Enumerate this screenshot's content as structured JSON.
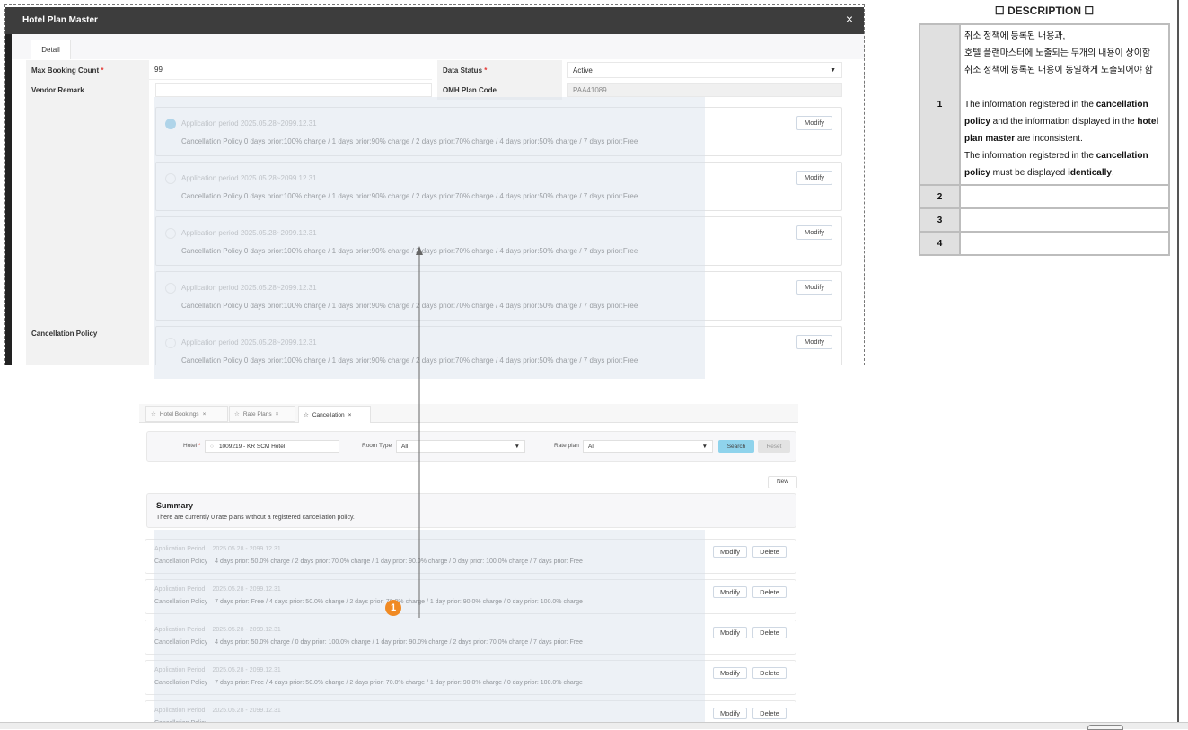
{
  "hotel_plan_master": {
    "title": "Hotel Plan Master",
    "close_icon": "×",
    "tab": "Detail",
    "max_booking_label": "Max Booking Count",
    "max_booking_value": "99",
    "vendor_remark_label": "Vendor Remark",
    "vendor_remark_value": "",
    "data_status_label": "Data Status",
    "data_status_value": "Active",
    "omh_plan_code_label": "OMH Plan Code",
    "omh_plan_code_value": "PAA41089",
    "cancellation_policy_label": "Cancellation Policy",
    "required_mark": "*",
    "modify_label": "Modify",
    "policies": [
      {
        "period": "Application period 2025.05.28~2099.12.31",
        "policy": "Cancellation Policy 0 days prior:100% charge / 1 days prior:90% charge / 2 days prior:70% charge / 4 days prior:50% charge / 7 days prior:Free",
        "selected": true
      },
      {
        "period": "Application period 2025.05.28~2099.12.31",
        "policy": "Cancellation Policy 0 days prior:100% charge / 1 days prior:90% charge / 2 days prior:70% charge / 4 days prior:50% charge / 7 days prior:Free",
        "selected": false
      },
      {
        "period": "Application period 2025.05.28~2099.12.31",
        "policy": "Cancellation Policy 0 days prior:100% charge / 1 days prior:90% charge / 2 days prior:70% charge / 4 days prior:50% charge / 7 days prior:Free",
        "selected": false
      },
      {
        "period": "Application period 2025.05.28~2099.12.31",
        "policy": "Cancellation Policy 0 days prior:100% charge / 1 days prior:90% charge / 2 days prior:70% charge / 4 days prior:50% charge / 7 days prior:Free",
        "selected": false
      },
      {
        "period": "Application period 2025.05.28~2099.12.31",
        "policy": "Cancellation Policy 0 days prior:100% charge / 1 days prior:90% charge / 2 days prior:70% charge / 4 days prior:50% charge / 7 days prior:Free",
        "selected": false
      }
    ]
  },
  "cancellation_page": {
    "tabs": [
      {
        "label": "Hotel Bookings"
      },
      {
        "label": "Rate Plans"
      },
      {
        "label": "Cancellation"
      }
    ],
    "tab_close": "×",
    "star_icon": "☆",
    "hotel_label": "Hotel",
    "hotel_value": "1009219 - KR SCM Hotel",
    "room_type_label": "Room Type",
    "room_type_value": "All",
    "rate_plan_label": "Rate plan",
    "rate_plan_value": "All",
    "search_label": "Search",
    "reset_label": "Reset",
    "new_label": "New",
    "summary_title": "Summary",
    "summary_text": "There are currently 0 rate plans without a registered cancellation policy.",
    "period_label": "Application Period",
    "policy_label": "Cancellation Policy",
    "modify_label": "Modify",
    "delete_label": "Delete",
    "rows": [
      {
        "period": "2025.05.28 - 2099.12.31",
        "policy": "4 days prior: 50.0% charge / 2 days prior: 70.0% charge / 1 day prior: 90.0% charge / 0 day prior: 100.0% charge / 7 days prior: Free"
      },
      {
        "period": "2025.05.28 - 2099.12.31",
        "policy": "7 days prior: Free / 4 days prior: 50.0% charge / 2 days prior: 70.0% charge / 1 day prior: 90.0% charge / 0 day prior: 100.0% charge"
      },
      {
        "period": "2025.05.28 - 2099.12.31",
        "policy": "4 days prior: 50.0% charge / 0 day prior: 100.0% charge / 1 day prior: 90.0% charge / 2 days prior: 70.0% charge / 7 days prior: Free"
      },
      {
        "period": "2025.05.28 - 2099.12.31",
        "policy": "7 days prior: Free / 4 days prior: 50.0% charge / 2 days prior: 70.0% charge / 1 day prior: 90.0% charge / 0 day prior: 100.0% charge"
      },
      {
        "period": "2025.05.28 - 2099.12.31",
        "policy": ""
      }
    ]
  },
  "annotation": {
    "marker": "1",
    "color": "#f08a24"
  },
  "description": {
    "title": "☐ DESCRIPTION ☐",
    "rows": [
      {
        "num": "1",
        "ko1": "취소 정책에 등록된 내용과,",
        "ko2": "호텔 플랜마스터에 노출되는 두개의 내용이 상이함",
        "ko3": "취소 정책에 등록된 내용이 동일하게 노출되어야 함",
        "en_a": "The information registered in the ",
        "en_b": "cancellation policy",
        "en_c": " and the information displayed in the ",
        "en_d": "hotel plan master",
        "en_e": " are inconsistent.",
        "en_f": "The information registered in the ",
        "en_g": "cancellation policy",
        "en_h": " must be displayed ",
        "en_i": "identically",
        "en_j": "."
      },
      {
        "num": "2"
      },
      {
        "num": "3"
      },
      {
        "num": "4"
      }
    ]
  }
}
